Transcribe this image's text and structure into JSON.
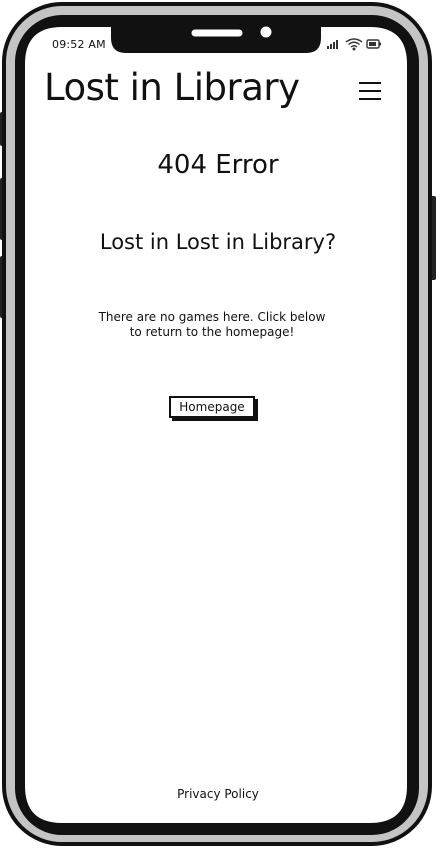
{
  "status_bar": {
    "time": "09:52 AM",
    "icons": [
      "signal-icon",
      "wifi-icon",
      "battery-icon"
    ]
  },
  "header": {
    "title": "Lost in Library",
    "menu_icon": "hamburger-menu-icon"
  },
  "main": {
    "error_code": "404 Error",
    "heading": "Lost in Lost in Library?",
    "message": "There are no games here. Click below to return to the homepage!",
    "button_label": "Homepage"
  },
  "footer": {
    "privacy_link": "Privacy Policy"
  }
}
